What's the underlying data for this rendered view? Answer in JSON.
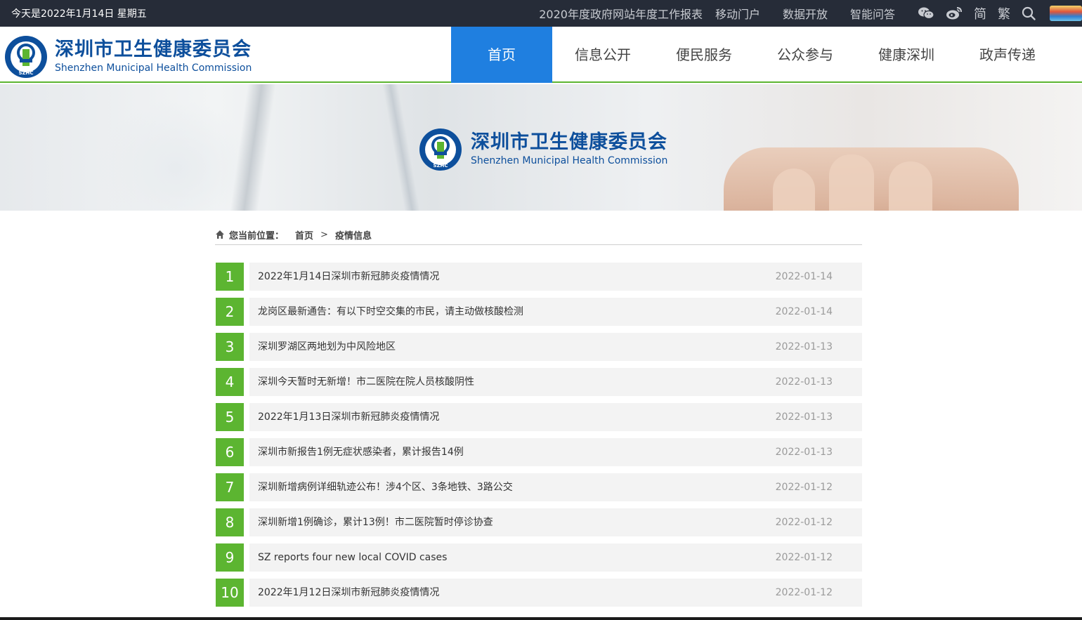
{
  "topbar": {
    "date": "今天是2022年1月14日 星期五",
    "links": [
      "2020年度政府网站年度工作报表",
      "移动门户",
      "数据开放",
      "智能问答"
    ],
    "tools": {
      "wechat_icon": "wechat-icon",
      "weibo_icon": "weibo-icon",
      "simplified": "简",
      "traditional": "繁",
      "search_icon": "search-icon"
    }
  },
  "brand": {
    "name_cn": "深圳市卫生健康委员会",
    "name_en": "Shenzhen Municipal Health Commission",
    "logo_text": "SZHC"
  },
  "nav": {
    "items": [
      "首页",
      "信息公开",
      "便民服务",
      "公众参与",
      "健康深圳",
      "政声传递"
    ],
    "active_index": 0
  },
  "banner": {
    "name_cn": "深圳市卫生健康委员会",
    "name_en": "Shenzhen Municipal Health Commission"
  },
  "breadcrumb": {
    "label": "您当前位置：",
    "home": "首页",
    "separator": ">",
    "current": "疫情信息"
  },
  "list": [
    {
      "num": "1",
      "title": "2022年1月14日深圳市新冠肺炎疫情情况",
      "date": "2022-01-14"
    },
    {
      "num": "2",
      "title": "龙岗区最新通告：有以下时空交集的市民，请主动做核酸检测",
      "date": "2022-01-14"
    },
    {
      "num": "3",
      "title": "深圳罗湖区两地划为中风险地区",
      "date": "2022-01-13"
    },
    {
      "num": "4",
      "title": "深圳今天暂时无新增！市二医院在院人员核酸阴性",
      "date": "2022-01-13"
    },
    {
      "num": "5",
      "title": "2022年1月13日深圳市新冠肺炎疫情情况",
      "date": "2022-01-13"
    },
    {
      "num": "6",
      "title": "深圳市新报告1例无症状感染者，累计报告14例",
      "date": "2022-01-13"
    },
    {
      "num": "7",
      "title": "深圳新增病例详细轨迹公布！涉4个区、3条地铁、3路公交",
      "date": "2022-01-12"
    },
    {
      "num": "8",
      "title": "深圳新增1例确诊，累计13例！市二医院暂时停诊协查",
      "date": "2022-01-12"
    },
    {
      "num": "9",
      "title": "SZ reports four new local COVID cases",
      "date": "2022-01-12"
    },
    {
      "num": "10",
      "title": "2022年1月12日深圳市新冠肺炎疫情情况",
      "date": "2022-01-12"
    }
  ],
  "colors": {
    "topbar_bg": "#262c38",
    "nav_active": "#1f7fe0",
    "accent_green": "#5cb531",
    "brand_blue": "#0d4f9c"
  }
}
